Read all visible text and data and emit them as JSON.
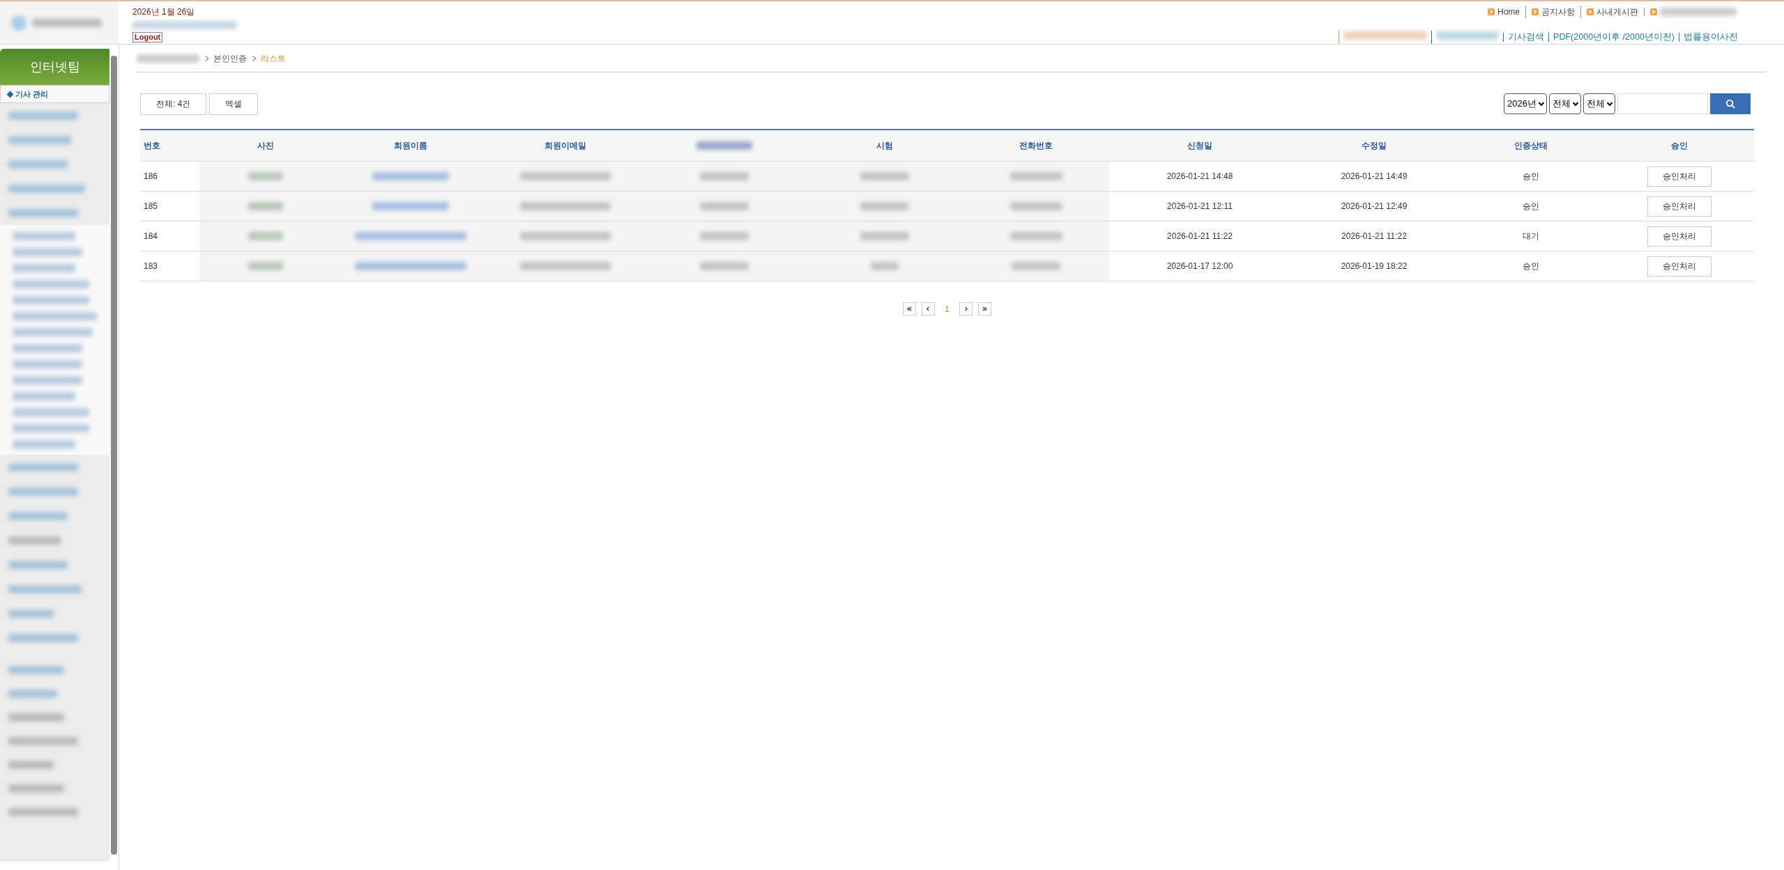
{
  "header": {
    "date": "2026년 1월 26일",
    "logout": "Logout"
  },
  "top_links": [
    {
      "label": "Home"
    },
    {
      "label": "공지사항"
    },
    {
      "label": "사내게시판"
    }
  ],
  "sub_links": [
    {
      "label": "기사검색"
    },
    {
      "label": "PDF(2000년이후 /2000년이전)"
    },
    {
      "label": "법률용어사전"
    }
  ],
  "sidebar": {
    "title": "인터넷팀",
    "items": [
      {
        "label": "기사 관리",
        "selected": true
      }
    ]
  },
  "breadcrumb": [
    {
      "label": "본인인증",
      "current": false
    },
    {
      "label": "리스트",
      "current": true
    }
  ],
  "toolbar": {
    "count": "전체: 4건",
    "excel": "엑셀",
    "year": "2026년",
    "filter_1": "전체",
    "filter_2": "전체"
  },
  "table": {
    "columns": [
      "번호",
      "사진",
      "회원이름",
      "회원이메일",
      "",
      "시험",
      "전화번호",
      "신청일",
      "수정일",
      "인증상태",
      "승인"
    ],
    "rows": [
      {
        "number": "186",
        "applied": "2026-01-21 14:48",
        "modified": "2026-01-21 14:49",
        "status": "승인",
        "action": "승인처리"
      },
      {
        "number": "185",
        "applied": "2026-01-21 12:11",
        "modified": "2026-01-21 12:49",
        "status": "승인",
        "action": "승인처리"
      },
      {
        "number": "184",
        "applied": "2026-01-21 11:22",
        "modified": "2026-01-21 11:22",
        "status": "대기",
        "action": "승인처리"
      },
      {
        "number": "183",
        "applied": "2026-01-17 12:00",
        "modified": "2026-01-19 18:22",
        "status": "승인",
        "action": "승인처리"
      }
    ]
  },
  "pagination": {
    "pages": [
      {
        "label": "1",
        "selected": true
      }
    ]
  }
}
